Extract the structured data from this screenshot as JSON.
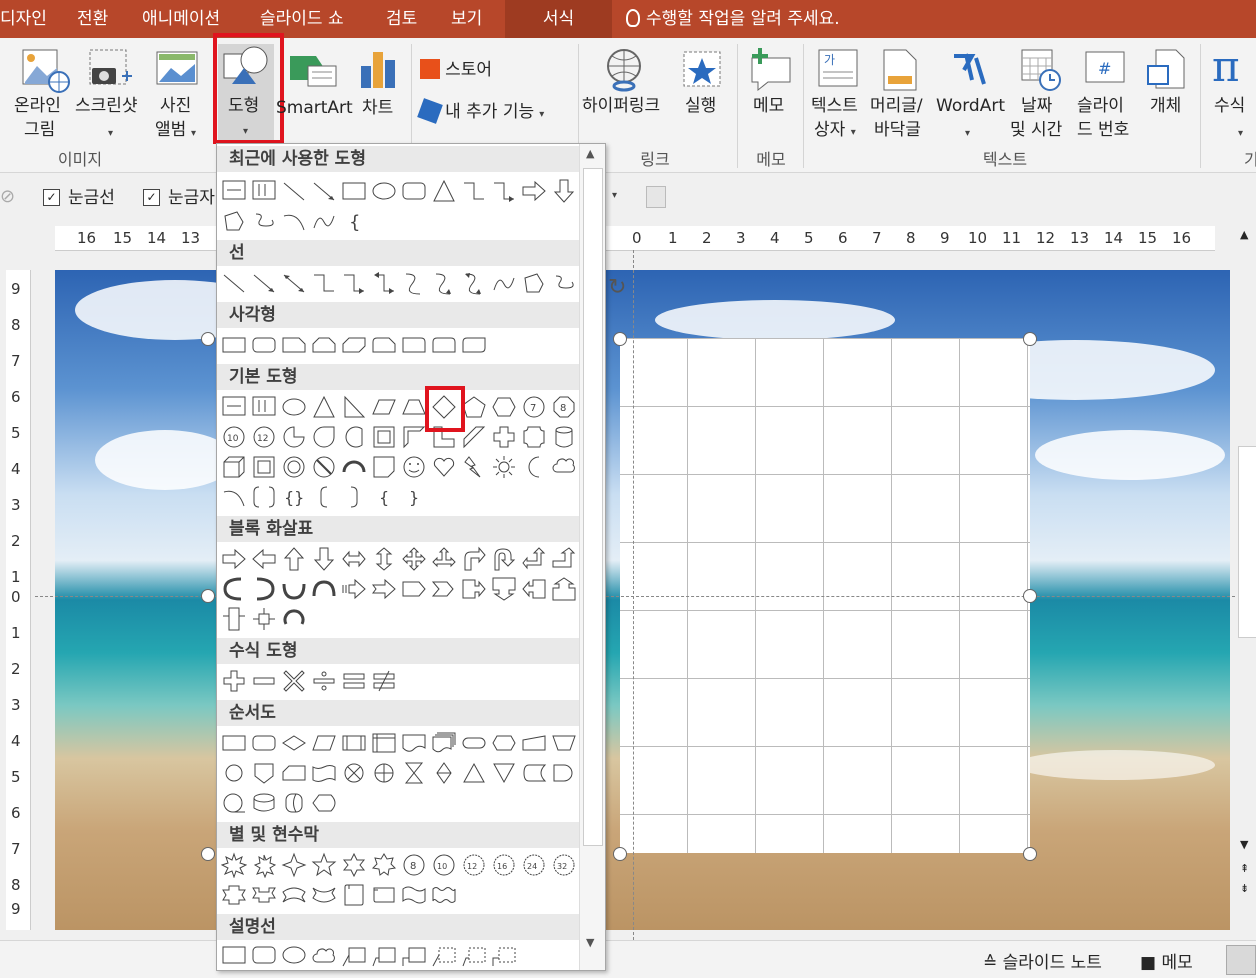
{
  "tabs": [
    {
      "label": "디자인"
    },
    {
      "label": "전환"
    },
    {
      "label": "애니메이션"
    },
    {
      "label": "슬라이드 쇼"
    },
    {
      "label": "검토"
    },
    {
      "label": "보기"
    },
    {
      "label": "서식"
    }
  ],
  "tell_me": "수행할 작업을 알려 주세요.",
  "ribbon": {
    "online_picture": [
      "온라인",
      "그림"
    ],
    "screenshot": "스크린샷",
    "album": [
      "사진",
      "앨범"
    ],
    "shapes": "도형",
    "smartart": "SmartArt",
    "chart": "차트",
    "store": "스토어",
    "my_addins": "내 추가 기능",
    "hyperlink": "하이퍼링크",
    "action": "실행",
    "comment": "메모",
    "textbox": [
      "텍스트",
      "상자"
    ],
    "header_footer": [
      "머리글/",
      "바닥글"
    ],
    "wordart": "WordArt",
    "datetime": [
      "날짜",
      "및 시간"
    ],
    "slide_number": [
      "슬라이",
      "드 번호"
    ],
    "object": "개체",
    "equation": "수식",
    "group_images": "이미지",
    "group_links": "링크",
    "group_comments": "메모",
    "group_text": "텍스트",
    "group_cut": "기"
  },
  "toolbar2": {
    "gridlines": "눈금선",
    "guides": "눈금자"
  },
  "hruler": [
    "16",
    "15",
    "14",
    "13",
    "0",
    "1",
    "2",
    "3",
    "4",
    "5",
    "6",
    "7",
    "8",
    "9",
    "10",
    "11",
    "12",
    "13",
    "14",
    "15",
    "16"
  ],
  "vruler": [
    "9",
    "8",
    "7",
    "6",
    "5",
    "4",
    "3",
    "2",
    "1",
    "0",
    "1",
    "2",
    "3",
    "4",
    "5",
    "6",
    "7",
    "8",
    "9"
  ],
  "dropdown": {
    "categories": [
      "최근에 사용한 도형",
      "선",
      "사각형",
      "기본 도형",
      "블록 화살표",
      "수식 도형",
      "순서도",
      "별 및 현수막",
      "설명선"
    ]
  },
  "status": {
    "notes": "슬라이드 노트",
    "comments": "메모"
  },
  "colors": {
    "ribbon_tab_bg": "#b7472a",
    "highlight": "#e0141e"
  }
}
